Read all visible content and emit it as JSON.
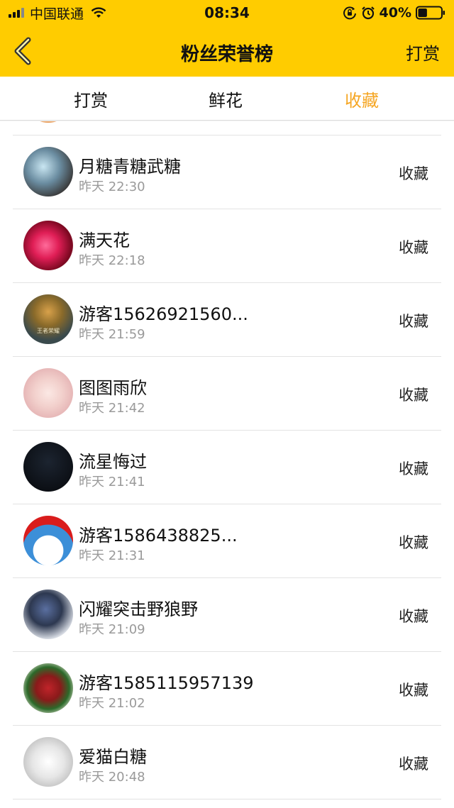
{
  "status_bar": {
    "carrier": "中国联通",
    "time": "08:34",
    "battery": "40%",
    "battery_level": 0.4,
    "icons": [
      "signal-icon",
      "wifi-icon",
      "orientation-lock-icon",
      "alarm-icon",
      "battery-icon"
    ]
  },
  "nav": {
    "back_icon": "chevron-left-icon",
    "title": "粉丝荣誉榜",
    "right_label": "打赏"
  },
  "tabs": [
    {
      "label": "打赏",
      "active": false
    },
    {
      "label": "鲜花",
      "active": false
    },
    {
      "label": "收藏",
      "active": true
    }
  ],
  "colors": {
    "brand_yellow": "#ffcc00",
    "active_tab": "#f5a623",
    "time_text": "#9a9a9a"
  },
  "list": [
    {
      "name": "月糖青糖武糖",
      "time": "昨天 22:30",
      "action": "收藏"
    },
    {
      "name": "满天花",
      "time": "昨天 22:18",
      "action": "收藏"
    },
    {
      "name": "游客15626921560...",
      "time": "昨天 21:59",
      "action": "收藏",
      "avatar_text": "王者荣耀"
    },
    {
      "name": "图图雨欣",
      "time": "昨天 21:42",
      "action": "收藏"
    },
    {
      "name": "流星悔过",
      "time": "昨天 21:41",
      "action": "收藏"
    },
    {
      "name": "游客1586438825...",
      "time": "昨天 21:31",
      "action": "收藏"
    },
    {
      "name": "闪耀突击野狼野",
      "time": "昨天 21:09",
      "action": "收藏"
    },
    {
      "name": "游客1585115957139",
      "time": "昨天 21:02",
      "action": "收藏"
    },
    {
      "name": "爱猫白糖",
      "time": "昨天 20:48",
      "action": "收藏"
    }
  ]
}
